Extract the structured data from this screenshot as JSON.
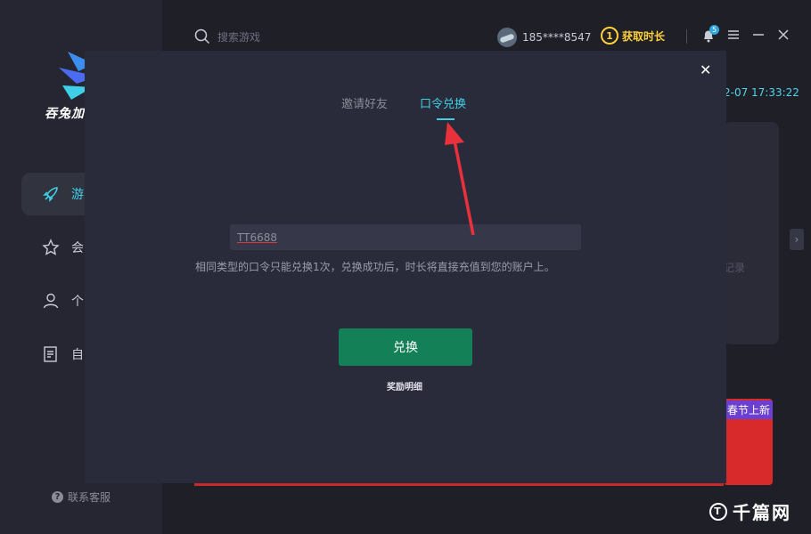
{
  "app": {
    "logo_text": "吞兔加",
    "accent_color": "#3fd0e8"
  },
  "sidebar": {
    "items": [
      {
        "label": "游",
        "icon": "rocket-icon",
        "active": true
      },
      {
        "label": "会",
        "icon": "star-icon",
        "active": false
      },
      {
        "label": "个",
        "icon": "user-icon",
        "active": false
      },
      {
        "label": "自",
        "icon": "document-icon",
        "active": false
      }
    ],
    "service_label": "联系客服"
  },
  "topbar": {
    "search_placeholder": "搜索游戏",
    "phone": "185****8547",
    "coin_label": "1",
    "get_time_label": "获取时长",
    "notification_count": "5"
  },
  "background": {
    "datetime": "2-07 17:33:22",
    "dim_text": "记录",
    "banner_text": "春节上新",
    "watermark": "千篇网"
  },
  "modal": {
    "tabs": [
      {
        "label": "邀请好友",
        "active": false
      },
      {
        "label": "口令兑换",
        "active": true
      }
    ],
    "code_value": "TT6688",
    "hint": "相同类型的口令只能兑换1次，兑换成功后，时长将直接充值到您的账户上。",
    "redeem_label": "兑换",
    "reward_link": "奖励明细",
    "close_symbol": "✕"
  }
}
